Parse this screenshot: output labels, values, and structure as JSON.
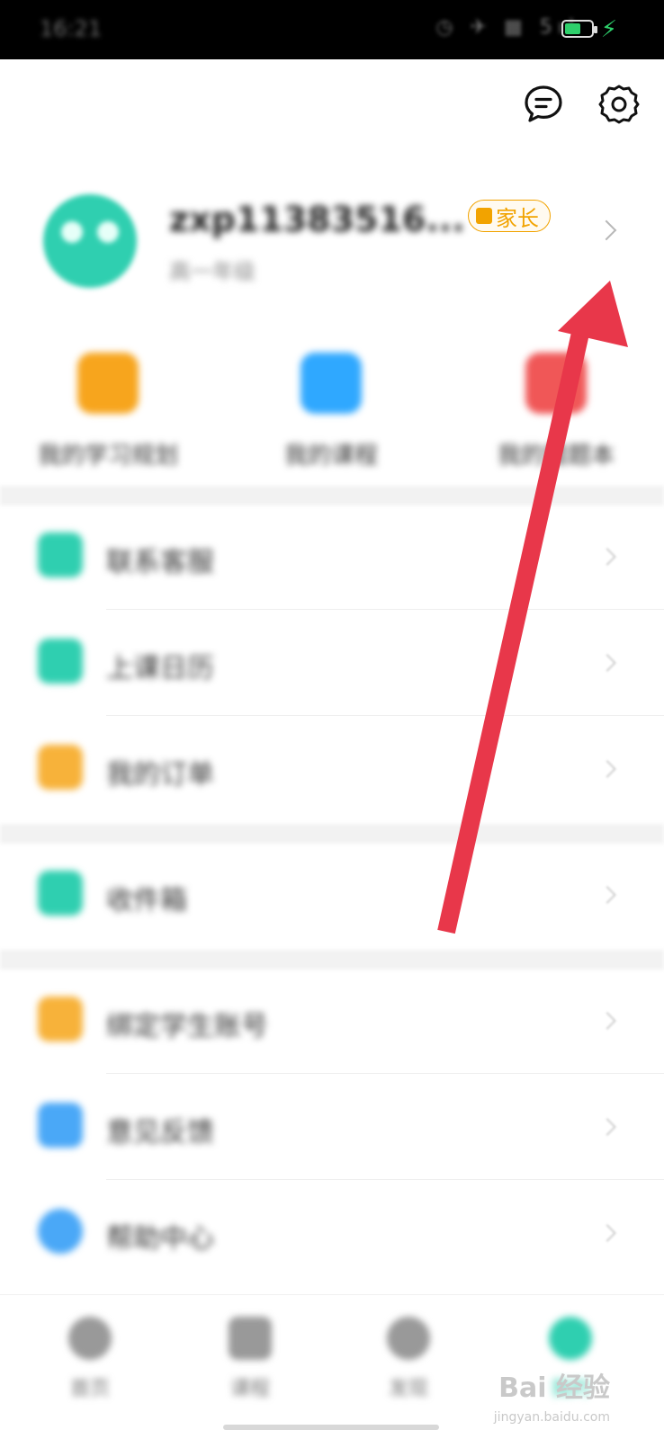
{
  "status_bar": {
    "time": "16:21",
    "icons": "◷ ✈ ▦ 5ıl",
    "battery_level": 0.6,
    "battery_color": "#2ecf6b"
  },
  "top_actions": {
    "message_icon": "message-icon",
    "settings_icon": "gear-icon"
  },
  "profile": {
    "username": "zxp11383516...",
    "subtitle": "高一年级",
    "role_badge": "家长",
    "accent_color": "#f2a300"
  },
  "quick_actions": [
    {
      "label": "我的学习规划",
      "icon": "study-plan-icon",
      "color": "#f7a51d"
    },
    {
      "label": "我的课程",
      "icon": "course-icon",
      "color": "#2fa8ff"
    },
    {
      "label": "我的错题本",
      "icon": "wrong-book-icon",
      "color": "#f05757"
    }
  ],
  "menu": [
    {
      "label": "联系客服",
      "icon": "service-icon",
      "color": "#2fcfb0"
    },
    {
      "label": "上课日历",
      "icon": "calendar-icon",
      "color": "#2fcfb0"
    },
    {
      "label": "我的订单",
      "icon": "order-icon",
      "color": "#f7b23a"
    },
    {
      "label": "收件箱",
      "icon": "inbox-icon",
      "color": "#2fcfb0"
    },
    {
      "label": "绑定学生账号",
      "icon": "link-icon",
      "color": "#f7b23a"
    },
    {
      "label": "意见反馈",
      "icon": "feedback-icon",
      "color": "#4aa8f7"
    },
    {
      "label": "帮助中心",
      "icon": "help-icon",
      "color": "#4aa8f7"
    }
  ],
  "tabs": [
    {
      "label": "首页",
      "icon": "home-icon",
      "color": "#999999"
    },
    {
      "label": "课程",
      "icon": "course-tab-icon",
      "color": "#999999"
    },
    {
      "label": "发现",
      "icon": "discover-icon",
      "color": "#999999"
    },
    {
      "label": "我的",
      "icon": "profile-tab-icon",
      "color": "#2fcfb0"
    }
  ],
  "watermark": {
    "text": "Bai 经验",
    "sub": "jingyan.baidu.com"
  },
  "annotation_color": "#e8374a"
}
